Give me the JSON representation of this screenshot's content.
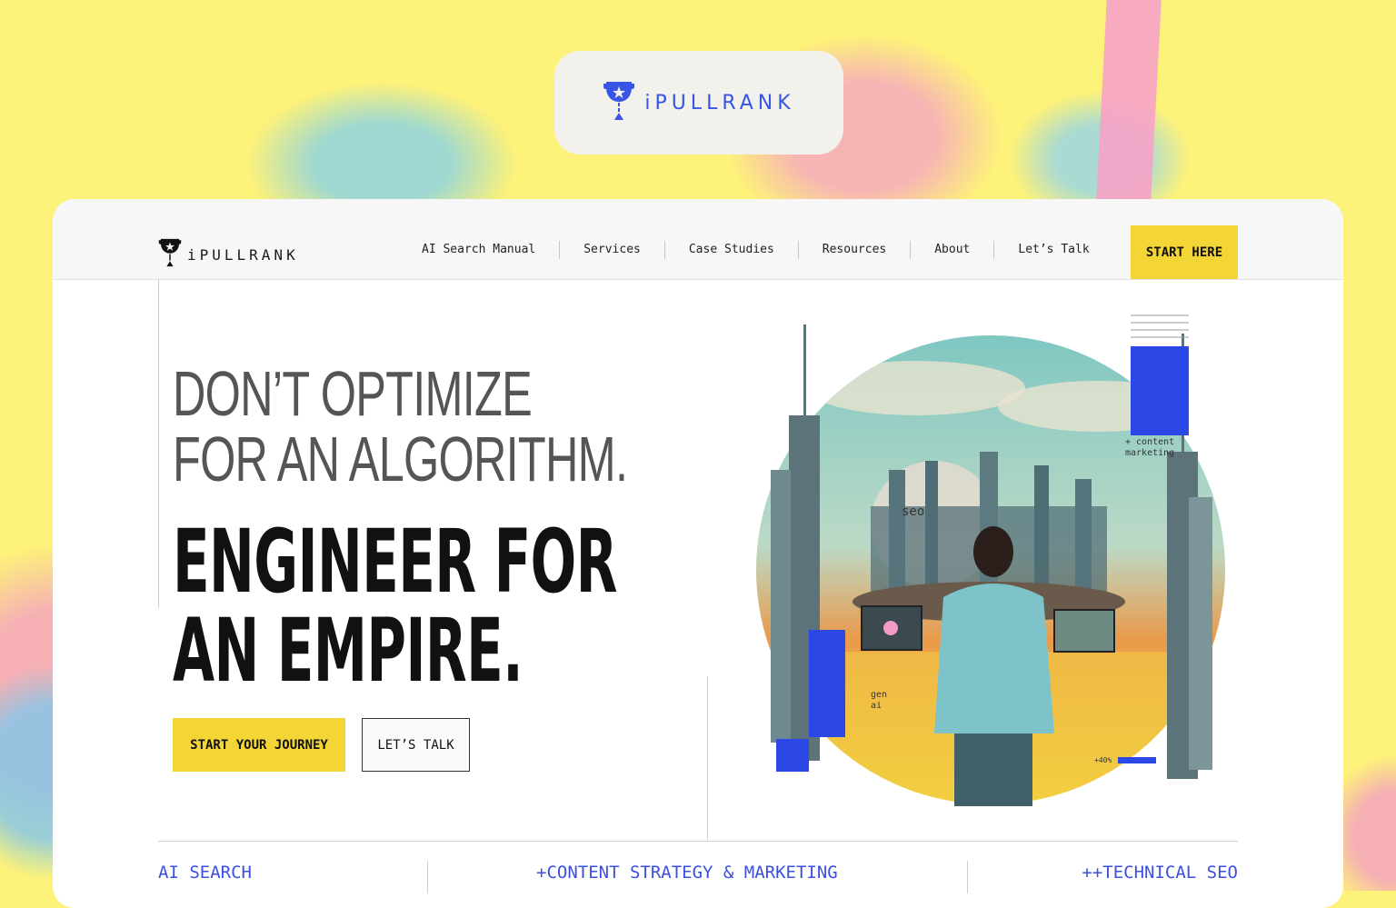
{
  "top_logo": {
    "brand": "iPULLRANK"
  },
  "nav": {
    "brand": "iPULLRANK",
    "items": [
      "AI Search Manual",
      "Services",
      "Case Studies",
      "Resources",
      "About",
      "Let’s Talk"
    ],
    "cta": "START HERE"
  },
  "hero": {
    "headline_light_1": "DON’T OPTIMIZE",
    "headline_light_2": "FOR AN ALGORITHM.",
    "headline_bold_1": "ENGINEER FOR",
    "headline_bold_2": "AN EMPIRE.",
    "primary_button": "START YOUR JOURNEY",
    "secondary_button": "LET’S TALK"
  },
  "art_labels": {
    "seo": "seo",
    "content_marketing_1": "+ content",
    "content_marketing_2": "marketing",
    "gen_ai_1": "gen",
    "gen_ai_2": "ai",
    "pct": "+40%"
  },
  "bottom_links": [
    "AI SEARCH",
    "+CONTENT STRATEGY & MARKETING",
    "++TECHNICAL SEO"
  ],
  "colors": {
    "accent_yellow": "#f3d635",
    "brand_blue": "#3855e6",
    "background": "#fdf27a"
  }
}
